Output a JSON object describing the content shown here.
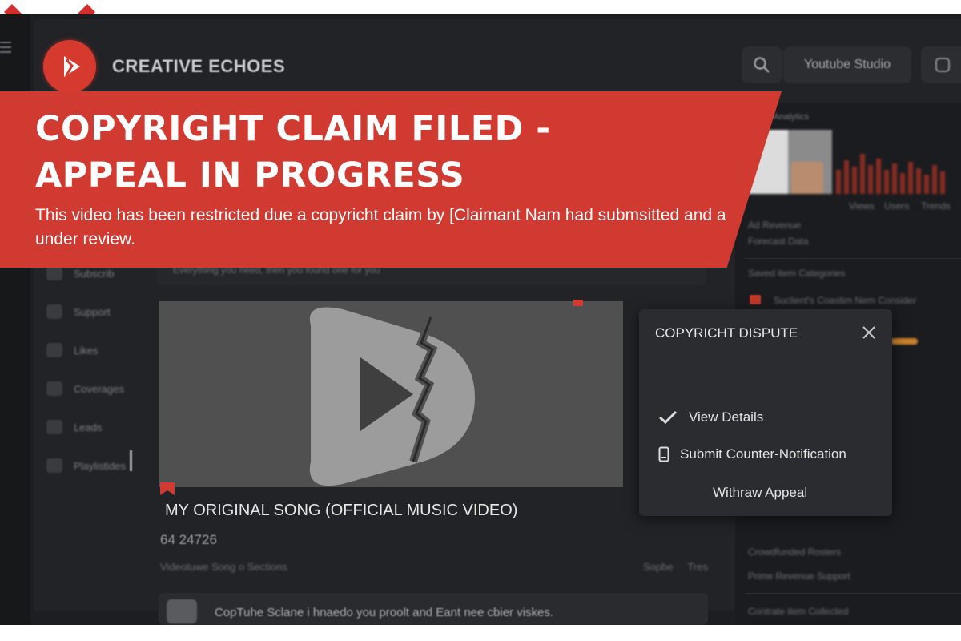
{
  "header": {
    "brand": "CREATIVE ECHOES",
    "studio_label": "Youtube Studio",
    "accent": "#d63a2f"
  },
  "banner": {
    "title_line1": "COPYRIGHT CLAIM FILED -",
    "title_line2": "APPEAL IN PROGRESS",
    "subtitle": "This video has been restricted due a copyricht claim by [Claimant Nam had submsitted and a under review.",
    "color": "#d03a31"
  },
  "sidebar": {
    "items": [
      {
        "label": "Subscrib",
        "icon": "inbox-icon"
      },
      {
        "label": "Support",
        "icon": "home-icon"
      },
      {
        "label": "Likes",
        "icon": "chat-icon"
      },
      {
        "label": "Coverages",
        "icon": "grid-icon"
      },
      {
        "label": "Leads",
        "icon": "card-icon"
      },
      {
        "label": "Playlistides",
        "icon": "play-icon"
      }
    ]
  },
  "main": {
    "top_strip": "Everything you need, then you found one for you",
    "video_title": "MY ORIGINAL SONG (OFFICIAL MUSIC VIDEO)",
    "views": "64 24726",
    "meta_left": "Videotuwe Song o Sections",
    "meta_right_1": "Sopbe",
    "meta_right_2": "Tres",
    "comment_text": "CopTuhe Sclane i hnaedo you proolt and Eant nee cbier viskes."
  },
  "right_panel": {
    "heading": "Analytics",
    "chart_labels": [
      "Views",
      "Users",
      "Trends"
    ],
    "lines": [
      "Ad Revenue",
      "Forecast Data",
      "Saved item Categories",
      "Suclient's Coastim Nem Consider",
      "Crowdfunded Rosters",
      "Prime Revenue Support",
      "Contrate item Collected"
    ]
  },
  "dispute": {
    "title": "COPYRICHT DISPUTE",
    "options": [
      {
        "label": "View Details",
        "icon": "check-icon"
      },
      {
        "label": "Submit Counter-Notification",
        "icon": "phone-icon"
      },
      {
        "label": "Withraw Appeal",
        "icon": ""
      }
    ]
  }
}
